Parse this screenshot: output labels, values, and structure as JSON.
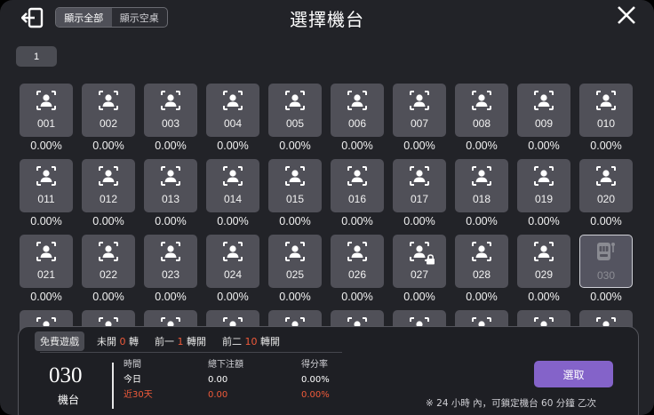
{
  "header": {
    "title": "選擇機台",
    "toggle": {
      "show_all": "顯示全部",
      "show_empty": "顯示空桌"
    },
    "page_button": "1"
  },
  "machines": [
    {
      "num": "001",
      "rate": "0.00%"
    },
    {
      "num": "002",
      "rate": "0.00%"
    },
    {
      "num": "003",
      "rate": "0.00%"
    },
    {
      "num": "004",
      "rate": "0.00%"
    },
    {
      "num": "005",
      "rate": "0.00%"
    },
    {
      "num": "006",
      "rate": "0.00%"
    },
    {
      "num": "007",
      "rate": "0.00%"
    },
    {
      "num": "008",
      "rate": "0.00%"
    },
    {
      "num": "009",
      "rate": "0.00%"
    },
    {
      "num": "010",
      "rate": "0.00%"
    },
    {
      "num": "011",
      "rate": "0.00%"
    },
    {
      "num": "012",
      "rate": "0.00%"
    },
    {
      "num": "013",
      "rate": "0.00%"
    },
    {
      "num": "014",
      "rate": "0.00%"
    },
    {
      "num": "015",
      "rate": "0.00%"
    },
    {
      "num": "016",
      "rate": "0.00%"
    },
    {
      "num": "017",
      "rate": "0.00%"
    },
    {
      "num": "018",
      "rate": "0.00%"
    },
    {
      "num": "019",
      "rate": "0.00%"
    },
    {
      "num": "020",
      "rate": "0.00%"
    },
    {
      "num": "021",
      "rate": "0.00%"
    },
    {
      "num": "022",
      "rate": "0.00%"
    },
    {
      "num": "023",
      "rate": "0.00%"
    },
    {
      "num": "024",
      "rate": "0.00%"
    },
    {
      "num": "025",
      "rate": "0.00%"
    },
    {
      "num": "026",
      "rate": "0.00%"
    },
    {
      "num": "027",
      "rate": "0.00%",
      "locked": true
    },
    {
      "num": "028",
      "rate": "0.00%"
    },
    {
      "num": "029",
      "rate": "0.00%"
    },
    {
      "num": "030",
      "rate": "0.00%",
      "selected": true
    },
    {
      "num": "",
      "rate": ""
    },
    {
      "num": "",
      "rate": ""
    },
    {
      "num": "",
      "rate": ""
    },
    {
      "num": "",
      "rate": ""
    },
    {
      "num": "",
      "rate": ""
    },
    {
      "num": "",
      "rate": ""
    },
    {
      "num": "",
      "rate": ""
    },
    {
      "num": "",
      "rate": ""
    },
    {
      "num": "",
      "rate": ""
    },
    {
      "num": "",
      "rate": ""
    }
  ],
  "panel": {
    "tabs": {
      "free_game": "免費遊戲",
      "unopened_label": "未開",
      "unopened_count": "0",
      "unopened_unit": "轉",
      "prev1_label": "前一",
      "prev1_count": "1",
      "prev1_unit": "轉開",
      "prev2_label": "前二",
      "prev2_count": "10",
      "prev2_unit": "轉開"
    },
    "selected_number": "030",
    "selected_label": "機台",
    "stats": {
      "time_head": "時間",
      "bet_head": "總下注額",
      "rate_head": "得分率",
      "today_label": "今日",
      "today_bet": "0.00",
      "today_rate": "0.00%",
      "days30_label": "近30天",
      "days30_bet": "0.00",
      "days30_rate": "0.00%"
    },
    "select_button": "選取",
    "note": "※ 24 小時 內，可鎖定機台 60 分鐘 乙次"
  },
  "colors": {
    "accent": "#8463c9",
    "highlight": "#f05a3a",
    "card": "#505058",
    "background": "#222328"
  }
}
